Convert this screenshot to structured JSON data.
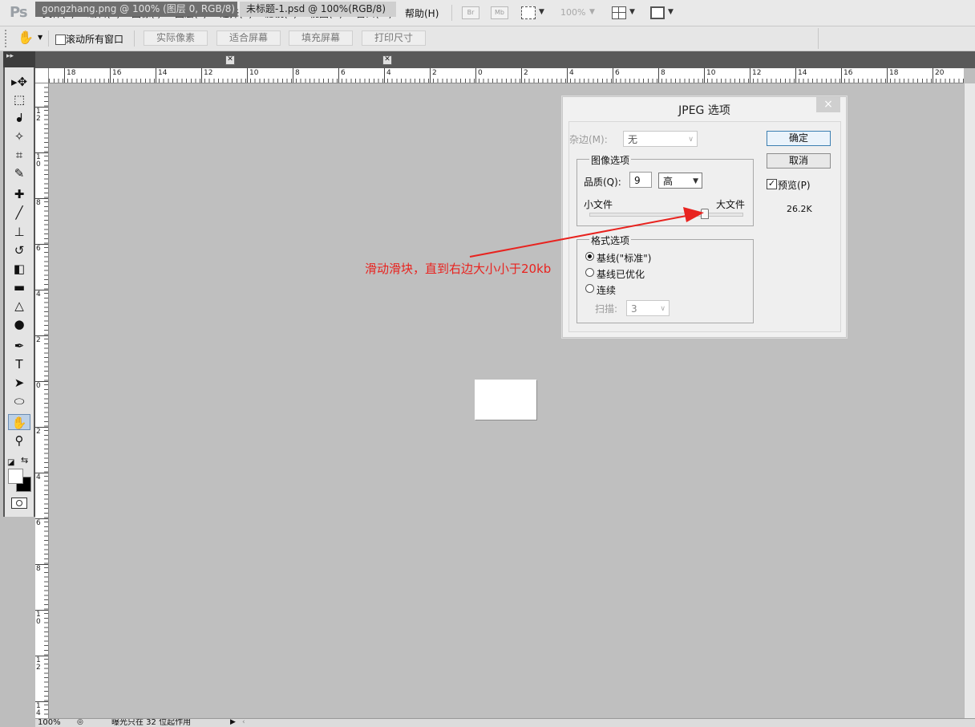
{
  "app": {
    "logo": "Ps"
  },
  "menu": [
    "文件(F)",
    "编辑(E)",
    "图像(I)",
    "图层(L)",
    "选择(S)",
    "滤镜(T)",
    "视图(V)",
    "窗口(W)",
    "帮助(H)"
  ],
  "menubar_extras": {
    "bridge": "Br",
    "mini_bridge": "Mb",
    "zoom": "100%"
  },
  "options": {
    "scroll_all_label": "滚动所有窗口",
    "scroll_all_checked": false,
    "buttons": [
      "实际像素",
      "适合屏幕",
      "填充屏幕",
      "打印尺寸"
    ]
  },
  "tabs": [
    {
      "label": "gongzhang.png @ 100% (图层 0, RGB/8)",
      "active": false
    },
    {
      "label": "未标题-1.psd @ 100%(RGB/8)",
      "active": true
    }
  ],
  "ruler_top_labels": [
    "18",
    "16",
    "14",
    "12",
    "10",
    "8",
    "6",
    "4",
    "2",
    "0",
    "2",
    "4",
    "6",
    "8",
    "10",
    "12",
    "14",
    "16",
    "18",
    "20"
  ],
  "ruler_left_labels": [
    "12",
    "10",
    "8",
    "6",
    "4",
    "2",
    "0",
    "2",
    "4",
    "6",
    "8",
    "10",
    "12",
    "14"
  ],
  "tools": [
    {
      "name": "move-tool-icon",
      "glyph": "▸✥"
    },
    {
      "name": "marquee-tool-icon",
      "glyph": "⬚"
    },
    {
      "name": "lasso-tool-icon",
      "glyph": "ᖱ"
    },
    {
      "name": "quick-select-tool-icon",
      "glyph": "✧"
    },
    {
      "name": "crop-tool-icon",
      "glyph": "⌗"
    },
    {
      "name": "eyedropper-tool-icon",
      "glyph": "✎"
    },
    {
      "name": "healing-brush-tool-icon",
      "glyph": "✚"
    },
    {
      "name": "brush-tool-icon",
      "glyph": "╱"
    },
    {
      "name": "clone-stamp-tool-icon",
      "glyph": "⊥"
    },
    {
      "name": "history-brush-tool-icon",
      "glyph": "↺"
    },
    {
      "name": "eraser-tool-icon",
      "glyph": "◧"
    },
    {
      "name": "gradient-tool-icon",
      "glyph": "▬"
    },
    {
      "name": "blur-tool-icon",
      "glyph": "△"
    },
    {
      "name": "dodge-tool-icon",
      "glyph": "●"
    },
    {
      "name": "pen-tool-icon",
      "glyph": "✒"
    },
    {
      "name": "type-tool-icon",
      "glyph": "T"
    },
    {
      "name": "path-select-tool-icon",
      "glyph": "➤"
    },
    {
      "name": "shape-tool-icon",
      "glyph": "⬭"
    },
    {
      "name": "hand-tool-icon",
      "glyph": "✋"
    },
    {
      "name": "zoom-tool-icon",
      "glyph": "⚲"
    }
  ],
  "dialog": {
    "title": "JPEG 选项",
    "close_glyph": "×",
    "matte_label": "杂边(M):",
    "matte_value": "无",
    "image_options_title": "图像选项",
    "quality_label": "品质(Q):",
    "quality_value": "9",
    "quality_preset": "高",
    "small_file": "小文件",
    "large_file": "大文件",
    "slider_level_fraction": 0.75,
    "format_options_title": "格式选项",
    "format_options": [
      {
        "label": "基线(\"标准\")",
        "selected": true
      },
      {
        "label": "基线已优化",
        "selected": false
      },
      {
        "label": "连续",
        "selected": false
      }
    ],
    "scans_label": "扫描:",
    "scans_value": "3",
    "ok_label": "确定",
    "cancel_label": "取消",
    "preview_label": "预览(P)",
    "preview_checked": true,
    "file_size": "26.2K"
  },
  "annotation": {
    "text": "滑动滑块，直到右边大小小于20kb",
    "color": "#e8231f"
  },
  "status": {
    "zoom": "100%",
    "info": "曝光只在 32 位起作用"
  }
}
